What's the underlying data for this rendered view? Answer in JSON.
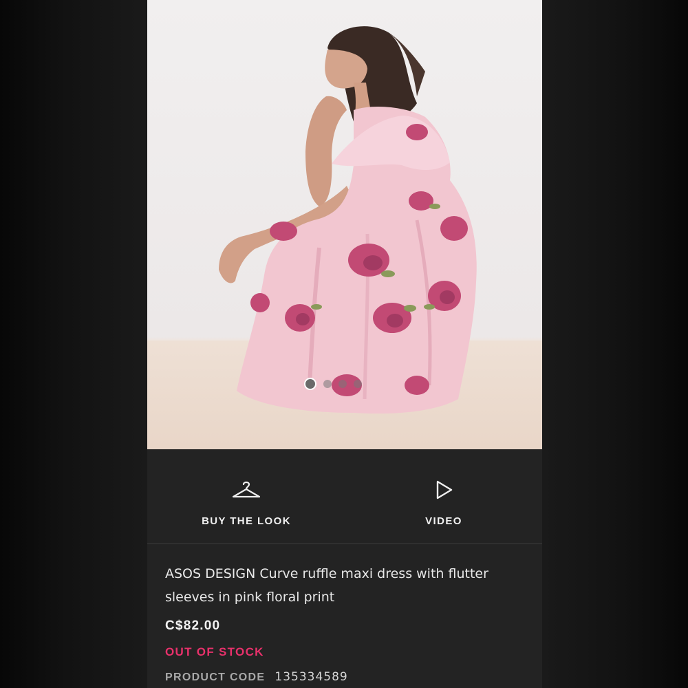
{
  "gallery": {
    "image_alt": "Model wearing pink floral ruffle maxi dress",
    "slide_count": 4,
    "active_slide": 1
  },
  "actions": {
    "buy_the_look": "BUY THE LOOK",
    "video": "VIDEO"
  },
  "product": {
    "title": "ASOS DESIGN Curve ruffle maxi dress with flutter sleeves in pink floral print",
    "price": "C$82.00",
    "stock_status": "OUT OF STOCK",
    "code_label": "PRODUCT CODE",
    "code_value": "135334589"
  },
  "colors": {
    "stock_alert": "#e8316b",
    "background": "#232323",
    "dress_pink": "#f2c3cf",
    "flower_rose": "#c24a74"
  },
  "icons": {
    "buy_the_look": "hanger-icon",
    "video": "play-icon"
  }
}
